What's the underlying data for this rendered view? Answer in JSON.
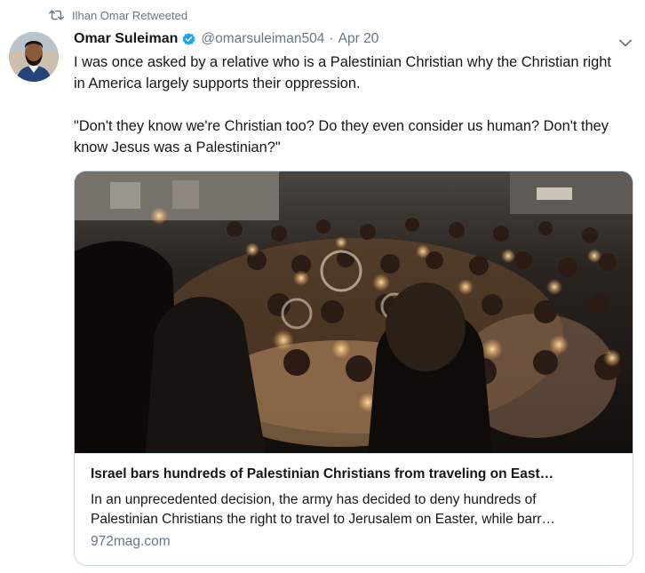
{
  "social_context": {
    "icon": "retweet-icon",
    "text": "Ilhan Omar Retweeted"
  },
  "author": {
    "display_name": "Omar Suleiman",
    "verified": true,
    "handle": "@omarsuleiman504",
    "separator": "·",
    "date": "Apr 20"
  },
  "tweet": {
    "paragraphs": [
      "I was once asked by a relative who is a Palestinian Christian why the Christian right in America largely supports their oppression.",
      "\"Don't they know we're Christian too? Do they even consider us human? Don't they know Jesus was a Palestinian?\""
    ]
  },
  "card": {
    "title": "Israel bars hundreds of Palestinian Christians from traveling on East…",
    "description_lines": [
      "In an unprecedented decision, the army has decided to deny hundreds of",
      "Palestinian Christians the right to travel to Jerusalem on Easter, while barr…"
    ],
    "domain": "972mag.com"
  },
  "colors": {
    "secondary_text": "#657786",
    "verified_blue": "#1da1f2",
    "border": "#ccd6dd",
    "text": "#14171a"
  }
}
